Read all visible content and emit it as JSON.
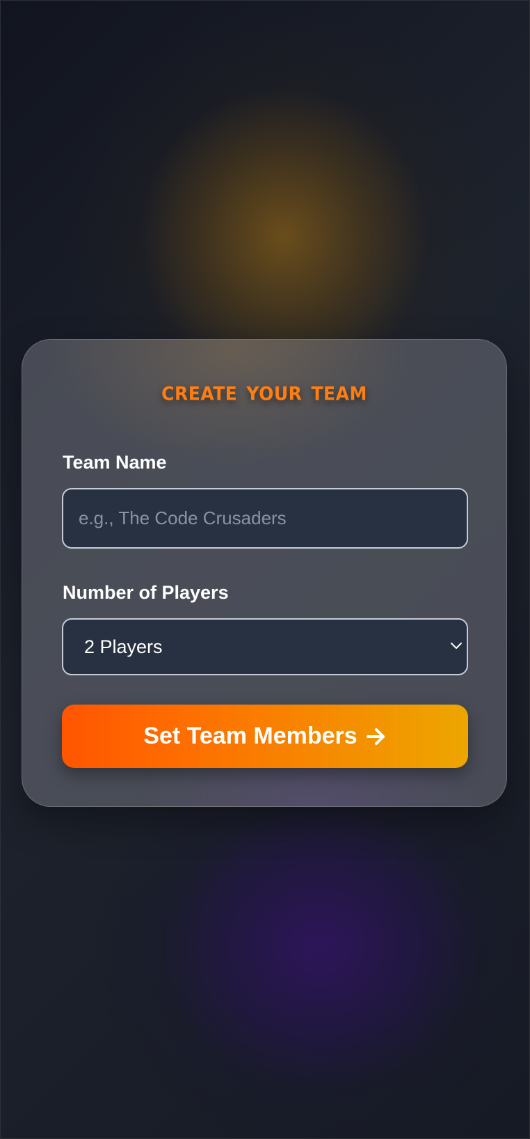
{
  "form": {
    "title": "Create Your Team",
    "team_name_label": "Team Name",
    "team_name_value": "",
    "team_name_placeholder": "e.g., The Code Crusaders",
    "players_label": "Number of Players",
    "players_selected": "2 Players",
    "submit_label": "Set Team Members",
    "submit_icon": "arrow-right-icon",
    "select_icon": "chevron-down-icon"
  },
  "colors": {
    "title": "#ff7e11",
    "button_start": "#ff5500",
    "button_end": "#eda600",
    "field_bg": "#283142"
  }
}
